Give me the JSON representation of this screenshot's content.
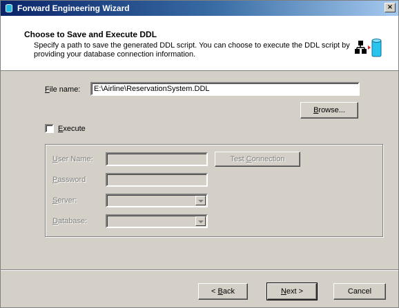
{
  "window": {
    "title": "Forward Engineering Wizard",
    "close_label": "×"
  },
  "header": {
    "title": "Choose to Save and Execute DDL",
    "description": "Specify a path to save the generated DDL script.  You can choose to execute the DDL script by providing your database connection information."
  },
  "file": {
    "label_prefix": "F",
    "label_rest": "ile name:",
    "value": "E:\\Airline\\ReservationSystem.DDL",
    "browse_prefix": "B",
    "browse_rest": "rowse..."
  },
  "execute": {
    "label_prefix": "E",
    "label_rest": "xecute",
    "checked": false
  },
  "connection": {
    "username": {
      "prefix": "U",
      "rest": "ser Name:"
    },
    "password": {
      "prefix": "P",
      "rest": "assword"
    },
    "server": {
      "prefix": "S",
      "rest": "erver:"
    },
    "database": {
      "prefix": "D",
      "rest": "atabase:"
    },
    "test_prefix": "Test ",
    "test_underlined": "C",
    "test_rest": "onnection"
  },
  "footer": {
    "back_prefix": "< ",
    "back_underlined": "B",
    "back_rest": "ack",
    "next_prefix": "N",
    "next_rest": "ext >",
    "cancel": "Cancel"
  }
}
